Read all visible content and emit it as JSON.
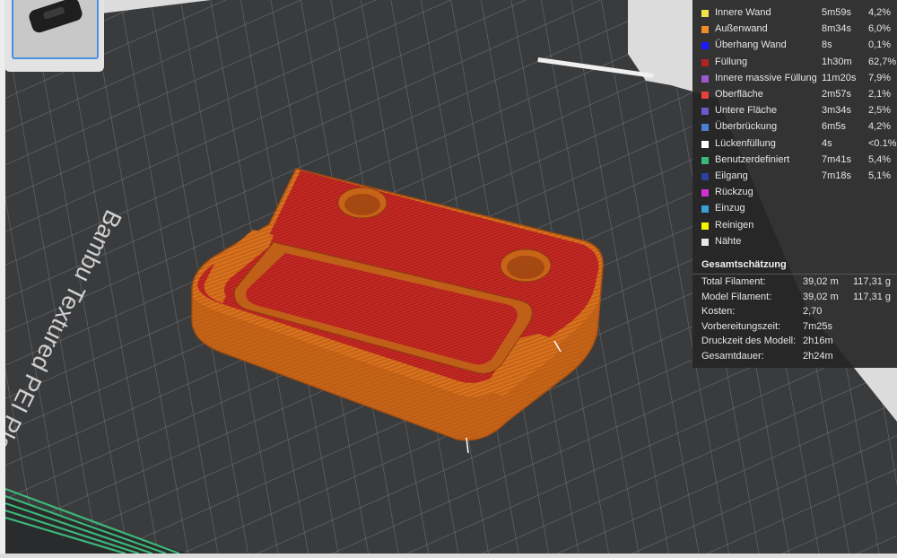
{
  "plate": {
    "label": "Bambu Textured PEI Plate"
  },
  "legend": {
    "rows": [
      {
        "name": "Innere Wand",
        "time": "5m59s",
        "percent": "4,2%",
        "color": "#f2e34a"
      },
      {
        "name": "Außenwand",
        "time": "8m34s",
        "percent": "6,0%",
        "color": "#f28c28"
      },
      {
        "name": "Überhang Wand",
        "time": "8s",
        "percent": "0,1%",
        "color": "#1a1aff"
      },
      {
        "name": "Füllung",
        "time": "1h30m",
        "percent": "62,7%",
        "color": "#b22222"
      },
      {
        "name": "Innere massive Füllung",
        "time": "11m20s",
        "percent": "7,9%",
        "color": "#9b59d0"
      },
      {
        "name": "Oberfläche",
        "time": "2m57s",
        "percent": "2,1%",
        "color": "#e8413a"
      },
      {
        "name": "Untere Fläche",
        "time": "3m34s",
        "percent": "2,5%",
        "color": "#6a5acd"
      },
      {
        "name": "Überbrückung",
        "time": "6m5s",
        "percent": "4,2%",
        "color": "#4a7fd4"
      },
      {
        "name": "Lückenfüllung",
        "time": "4s",
        "percent": "<0.1%",
        "color": "#ffffff"
      },
      {
        "name": "Benutzerdefiniert",
        "time": "7m41s",
        "percent": "5,4%",
        "color": "#3cb878"
      },
      {
        "name": "Eilgang",
        "time": "7m18s",
        "percent": "5,1%",
        "color": "#2e3f9e"
      },
      {
        "name": "Rückzug",
        "time": "",
        "percent": "",
        "color": "#d42fd4"
      },
      {
        "name": "Einzug",
        "time": "",
        "percent": "",
        "color": "#3aa0d8"
      },
      {
        "name": "Reinigen",
        "time": "",
        "percent": "",
        "color": "#f5f500"
      },
      {
        "name": "Nähte",
        "time": "",
        "percent": "",
        "color": "#e8e8e8"
      }
    ]
  },
  "estimate": {
    "title": "Gesamtschätzung",
    "rows": [
      {
        "label": "Total Filament:",
        "value": "39,02 m",
        "extra": "117,31 g"
      },
      {
        "label": "Model Filament:",
        "value": "39,02 m",
        "extra": "117,31 g"
      },
      {
        "label": "Kosten:",
        "value": "2,70",
        "extra": ""
      },
      {
        "label": "Vorbereitungszeit:",
        "value": "7m25s",
        "extra": ""
      },
      {
        "label": "Druckzeit des Modell:",
        "value": "2h16m",
        "extra": ""
      },
      {
        "label": "Gesamtdauer:",
        "value": "2h24m",
        "extra": ""
      }
    ]
  }
}
